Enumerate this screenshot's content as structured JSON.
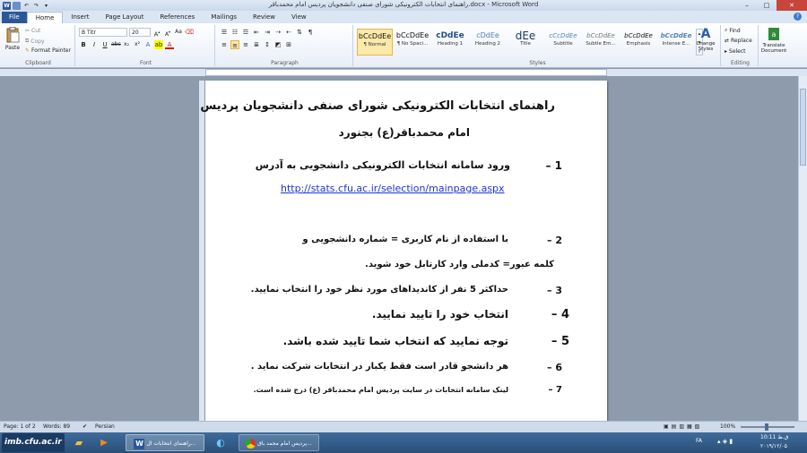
{
  "window": {
    "title": "راهنمای انتخابات الکترونیکی شورای صنفی دانشجویان پردیس امام محمدباقر.docx - Microsoft Word"
  },
  "tabs": [
    "File",
    "Home",
    "Insert",
    "Page Layout",
    "References",
    "Mailings",
    "Review",
    "View"
  ],
  "clipboard": {
    "paste": "Paste",
    "cut": "Cut",
    "copy": "Copy",
    "format_painter": "Format Painter",
    "label": "Clipboard"
  },
  "font": {
    "name": "B Titr",
    "size": "20",
    "label": "Font"
  },
  "paragraph": {
    "label": "Paragraph"
  },
  "styles": {
    "label": "Styles",
    "items": [
      {
        "preview": "bCcDdEe",
        "name": "¶ Normal"
      },
      {
        "preview": "bCcDdEe",
        "name": "¶ No Spaci..."
      },
      {
        "preview": "cDdEe",
        "name": "Heading 1"
      },
      {
        "preview": "cDdEe",
        "name": "Heading 2"
      },
      {
        "preview": "dEe",
        "name": "Title"
      },
      {
        "preview": "cCcDdEe",
        "name": "Subtitle"
      },
      {
        "preview": "bCcDdEe",
        "name": "Subtle Em..."
      },
      {
        "preview": "bCcDdEe",
        "name": "Emphasis"
      },
      {
        "preview": "bCcDdEe",
        "name": "Intense E..."
      }
    ],
    "change_styles": "Change Styles"
  },
  "editing": {
    "find": "Find",
    "replace": "Replace",
    "select": "Select",
    "label": "Editing"
  },
  "translate": "Translate Document",
  "document": {
    "title_line1": "راهنمای انتخابات الکترونیکی شورای صنفی دانشجویان پردیس",
    "title_line2": "امام محمدباقر(ع) بجنورد",
    "item1_num": "1 –",
    "item1_text": "ورود  سامانه انتخابات الکترونیکی دانشجویی  به آدرس",
    "item1_link": "http://stats.cfu.ac.ir/selection/mainpage.aspx",
    "item2_num": "2 –",
    "item2_text": "با استفاده از       نام کاربری = شماره دانشجویی       و",
    "item2_cont": "کلمه عبور= کدملی     وارد کارتابل خود شوید.",
    "item3_num": "3 –",
    "item3_text": "حداکثر 5 نفر از کاندیداهای مورد نظر خود را انتخاب نمایید.",
    "item4_num": "4 –",
    "item4_text": "انتخاب خود را تایید نمایید.",
    "item5_num": "5 –",
    "item5_text": "توجه نمایید که انتخاب شما تایید شده باشد.",
    "item6_num": "6 –",
    "item6_text": "هر دانشجو قادر است فقط یکبار در انتخابات شرکت نماید .",
    "item7_num": "7 –",
    "item7_text": "لینک سامانه انتخابات در سایت پردیس امام محمدباقر (ع) درج شده است."
  },
  "status": {
    "page": "Page: 1 of 2",
    "words": "Words: 89",
    "language": "Persian",
    "zoom": "100%"
  },
  "taskbar": {
    "word_item": "راهنمای انتخابات ال...",
    "chrome_item": "پردیس امام محمد باق...",
    "lang": "FA",
    "time": "10:11 ق.ظ",
    "date": "۲۰۱۹/۱۲/۰۵",
    "watermark": "imb.cfu.ac.ir"
  }
}
